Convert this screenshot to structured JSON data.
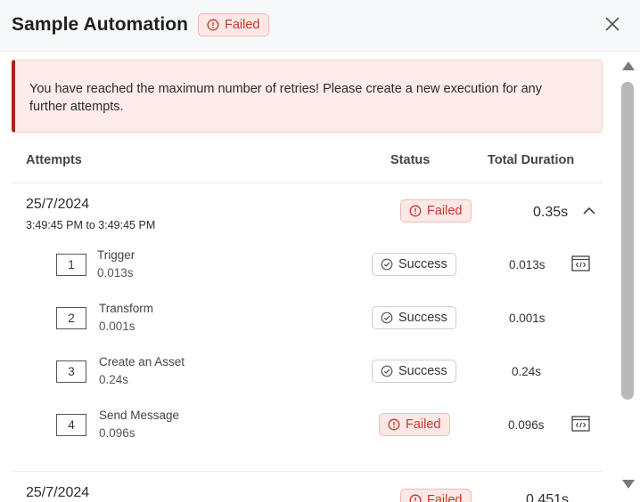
{
  "header": {
    "title": "Sample Automation",
    "status": "Failed"
  },
  "alert": {
    "message": "You have reached the maximum number of retries! Please create a new execution for any further attempts."
  },
  "table": {
    "headers": {
      "attempts": "Attempts",
      "status": "Status",
      "duration": "Total Duration"
    }
  },
  "attempts": [
    {
      "date": "25/7/2024",
      "time_range": "3:49:45 PM to 3:49:45 PM",
      "status": "Failed",
      "duration": "0.35s",
      "steps": [
        {
          "number": "1",
          "name": "Trigger",
          "time": "0.013s",
          "status": "Success",
          "duration": "0.013s",
          "has_code": true
        },
        {
          "number": "2",
          "name": "Transform",
          "time": "0.001s",
          "status": "Success",
          "duration": "0.001s",
          "has_code": false
        },
        {
          "number": "3",
          "name": "Create an Asset",
          "time": "0.24s",
          "status": "Success",
          "duration": "0.24s",
          "has_code": false
        },
        {
          "number": "4",
          "name": "Send Message",
          "time": "0.096s",
          "status": "Failed",
          "duration": "0.096s",
          "has_code": true
        }
      ]
    },
    {
      "date": "25/7/2024",
      "status": "Failed",
      "duration": "0.451s"
    }
  ],
  "colors": {
    "failed_text": "#c0392b",
    "failed_bg": "#fde8e6",
    "alert_border": "#a8261b"
  }
}
